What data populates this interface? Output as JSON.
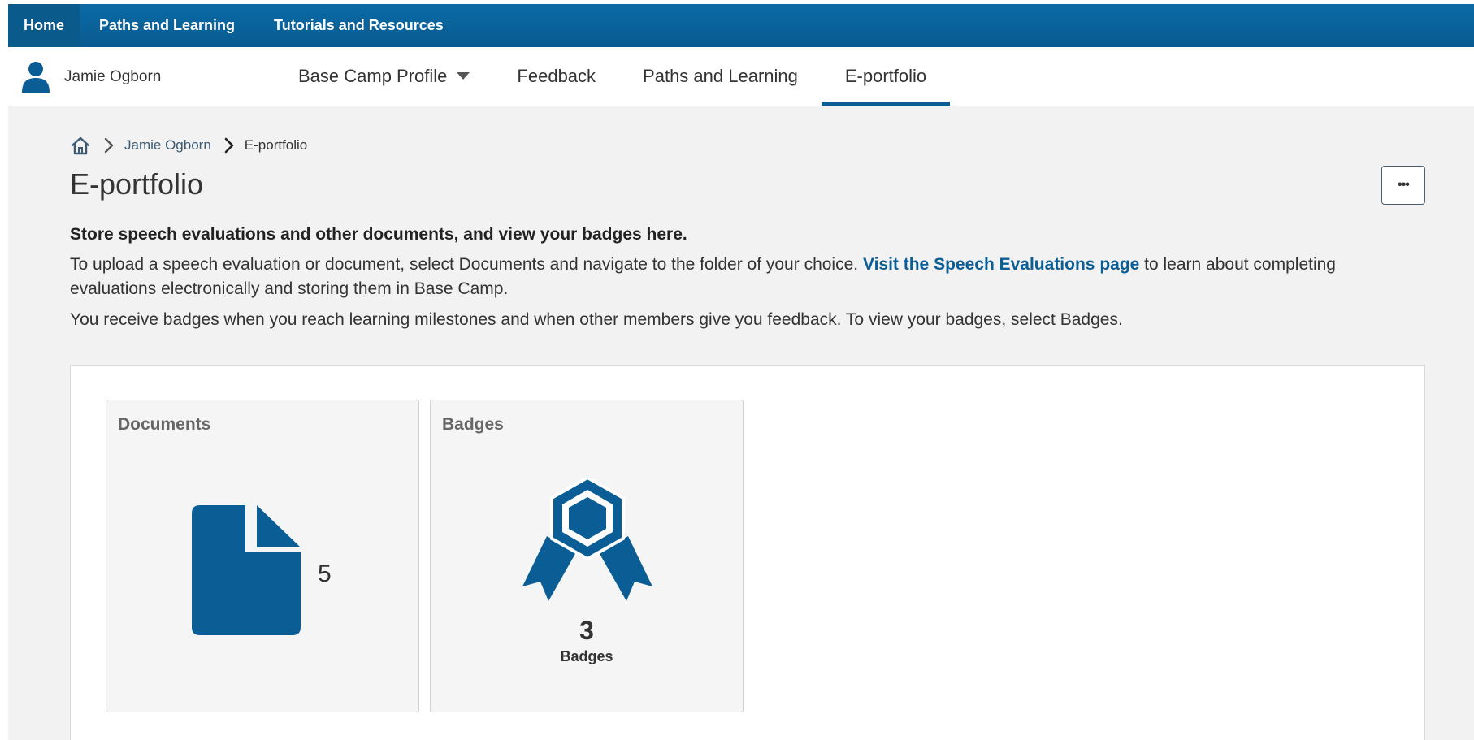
{
  "topnav": {
    "items": [
      {
        "label": "Home"
      },
      {
        "label": "Paths and Learning"
      },
      {
        "label": "Tutorials and Resources"
      }
    ]
  },
  "profile": {
    "name": "Jamie Ogborn",
    "tabs": [
      {
        "label": "Base Camp Profile"
      },
      {
        "label": "Feedback"
      },
      {
        "label": "Paths and Learning"
      },
      {
        "label": "E-portfolio"
      }
    ],
    "active_tab": "E-portfolio"
  },
  "breadcrumb": {
    "items": [
      {
        "label": "Jamie Ogborn"
      },
      {
        "label": "E-portfolio"
      }
    ]
  },
  "page": {
    "title": "E-portfolio",
    "more_label": "•••",
    "lead": "Store speech evaluations and other documents, and view your badges here.",
    "para1_before": "To upload a speech evaluation or document, select Documents and navigate to the folder of your choice. ",
    "para1_link": "Visit the Speech Evaluations page",
    "para1_after": " to learn about completing evaluations electronically and storing them in Base Camp.",
    "para2": "You receive badges when you reach learning milestones and when other members give you feedback. To view your badges, select Badges."
  },
  "tiles": {
    "documents": {
      "title": "Documents",
      "count": "5",
      "icon": "document-icon"
    },
    "badges": {
      "title": "Badges",
      "count": "3",
      "label": "Badges",
      "icon": "badge-ribbon-icon"
    }
  },
  "colors": {
    "brand": "#0b5e95",
    "topnav": "#0b6aa6",
    "page_bg": "#f2f2f2"
  }
}
